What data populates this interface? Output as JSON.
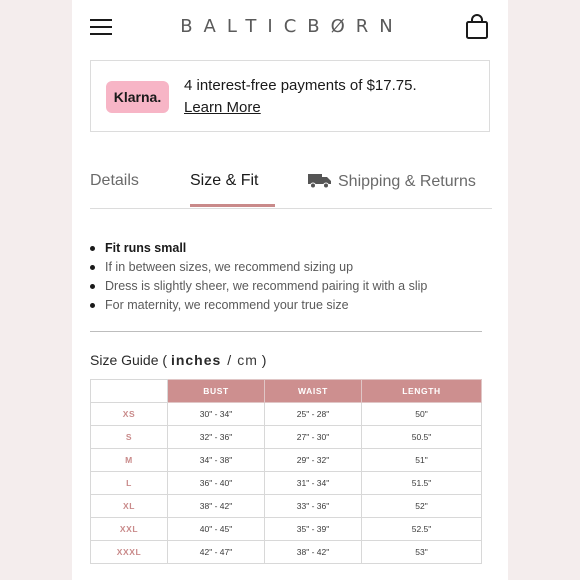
{
  "header": {
    "logo": "BALTICBØRN",
    "menu_icon": "hamburger-menu-icon",
    "bag_icon": "shopping-bag-icon"
  },
  "klarna": {
    "badge": "Klarna.",
    "message": "4 interest-free payments of $17.75.",
    "link": "Learn More",
    "badge_color": "#f7b5c6"
  },
  "tabs": {
    "details": "Details",
    "size_fit": "Size & Fit",
    "shipping": "Shipping & Returns",
    "active": "Size & Fit",
    "accent_color": "#c98a8a",
    "shipping_icon": "truck-icon"
  },
  "fit_notes": [
    "Fit runs small",
    "If in between sizes, we recommend sizing up",
    "Dress is slightly sheer, we recommend pairing it with a slip",
    "For maternity, we recommend your true size"
  ],
  "size_guide": {
    "label": "Size Guide (",
    "unit_inches": "inches",
    "unit_cm": "cm",
    "close_paren": ")",
    "selected_unit": "inches",
    "columns": [
      "BUST",
      "WAIST",
      "LENGTH"
    ],
    "header_color": "#cd8f8f",
    "rows": [
      [
        "XS",
        "30\" - 34\"",
        "25\" - 28\"",
        "50\""
      ],
      [
        "S",
        "32\" - 36\"",
        "27\" - 30\"",
        "50.5\""
      ],
      [
        "M",
        "34\" - 38\"",
        "29\" - 32\"",
        "51\""
      ],
      [
        "L",
        "36\" - 40\"",
        "31\" - 34\"",
        "51.5\""
      ],
      [
        "XL",
        "38\" - 42\"",
        "33\" - 36\"",
        "52\""
      ],
      [
        "XXL",
        "40\" - 45\"",
        "35\" - 39\"",
        "52.5\""
      ],
      [
        "XXXL",
        "42\" - 47\"",
        "38\" - 42\"",
        "53\""
      ]
    ]
  }
}
